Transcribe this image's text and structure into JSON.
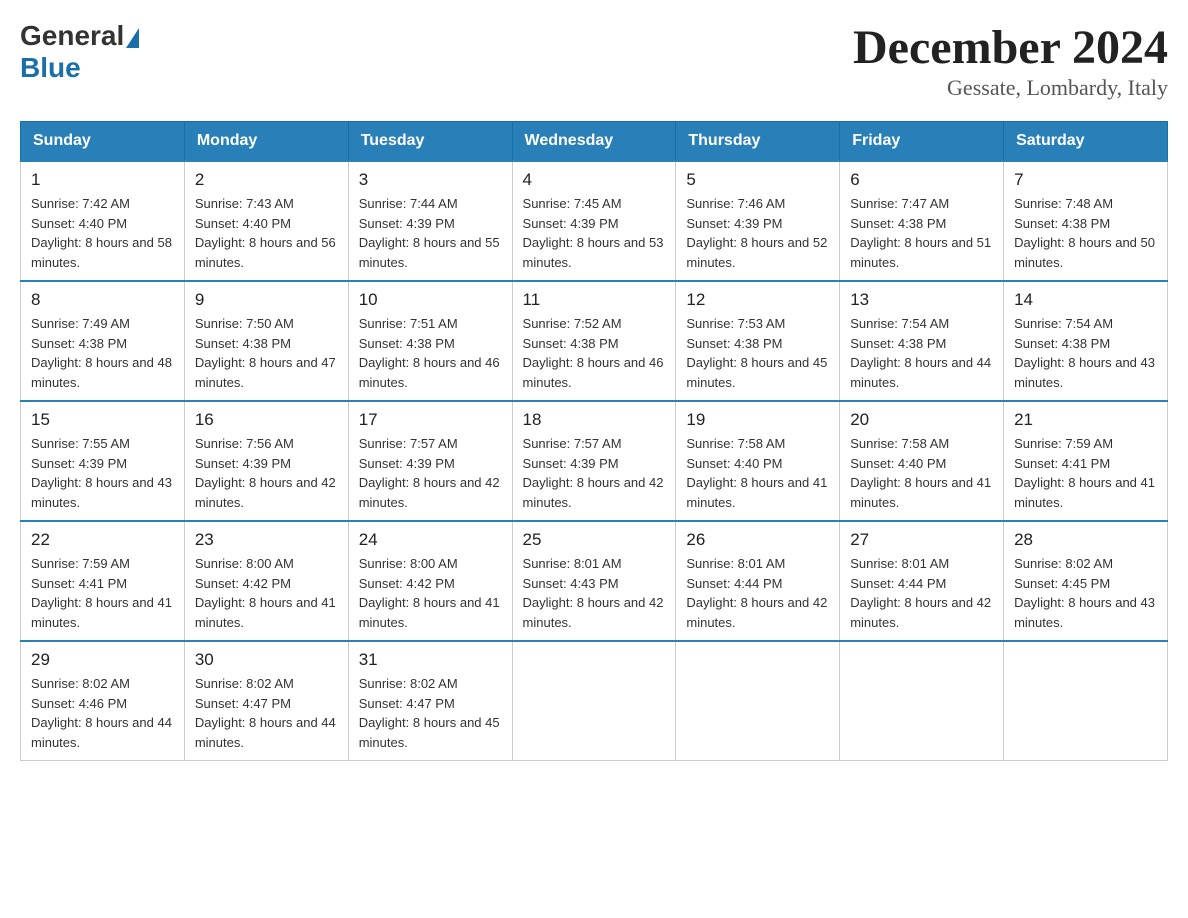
{
  "logo": {
    "general": "General",
    "blue": "Blue",
    "triangle": "▶"
  },
  "title": "December 2024",
  "location": "Gessate, Lombardy, Italy",
  "days_of_week": [
    "Sunday",
    "Monday",
    "Tuesday",
    "Wednesday",
    "Thursday",
    "Friday",
    "Saturday"
  ],
  "weeks": [
    [
      {
        "day": "1",
        "sunrise": "7:42 AM",
        "sunset": "4:40 PM",
        "daylight": "8 hours and 58 minutes."
      },
      {
        "day": "2",
        "sunrise": "7:43 AM",
        "sunset": "4:40 PM",
        "daylight": "8 hours and 56 minutes."
      },
      {
        "day": "3",
        "sunrise": "7:44 AM",
        "sunset": "4:39 PM",
        "daylight": "8 hours and 55 minutes."
      },
      {
        "day": "4",
        "sunrise": "7:45 AM",
        "sunset": "4:39 PM",
        "daylight": "8 hours and 53 minutes."
      },
      {
        "day": "5",
        "sunrise": "7:46 AM",
        "sunset": "4:39 PM",
        "daylight": "8 hours and 52 minutes."
      },
      {
        "day": "6",
        "sunrise": "7:47 AM",
        "sunset": "4:38 PM",
        "daylight": "8 hours and 51 minutes."
      },
      {
        "day": "7",
        "sunrise": "7:48 AM",
        "sunset": "4:38 PM",
        "daylight": "8 hours and 50 minutes."
      }
    ],
    [
      {
        "day": "8",
        "sunrise": "7:49 AM",
        "sunset": "4:38 PM",
        "daylight": "8 hours and 48 minutes."
      },
      {
        "day": "9",
        "sunrise": "7:50 AM",
        "sunset": "4:38 PM",
        "daylight": "8 hours and 47 minutes."
      },
      {
        "day": "10",
        "sunrise": "7:51 AM",
        "sunset": "4:38 PM",
        "daylight": "8 hours and 46 minutes."
      },
      {
        "day": "11",
        "sunrise": "7:52 AM",
        "sunset": "4:38 PM",
        "daylight": "8 hours and 46 minutes."
      },
      {
        "day": "12",
        "sunrise": "7:53 AM",
        "sunset": "4:38 PM",
        "daylight": "8 hours and 45 minutes."
      },
      {
        "day": "13",
        "sunrise": "7:54 AM",
        "sunset": "4:38 PM",
        "daylight": "8 hours and 44 minutes."
      },
      {
        "day": "14",
        "sunrise": "7:54 AM",
        "sunset": "4:38 PM",
        "daylight": "8 hours and 43 minutes."
      }
    ],
    [
      {
        "day": "15",
        "sunrise": "7:55 AM",
        "sunset": "4:39 PM",
        "daylight": "8 hours and 43 minutes."
      },
      {
        "day": "16",
        "sunrise": "7:56 AM",
        "sunset": "4:39 PM",
        "daylight": "8 hours and 42 minutes."
      },
      {
        "day": "17",
        "sunrise": "7:57 AM",
        "sunset": "4:39 PM",
        "daylight": "8 hours and 42 minutes."
      },
      {
        "day": "18",
        "sunrise": "7:57 AM",
        "sunset": "4:39 PM",
        "daylight": "8 hours and 42 minutes."
      },
      {
        "day": "19",
        "sunrise": "7:58 AM",
        "sunset": "4:40 PM",
        "daylight": "8 hours and 41 minutes."
      },
      {
        "day": "20",
        "sunrise": "7:58 AM",
        "sunset": "4:40 PM",
        "daylight": "8 hours and 41 minutes."
      },
      {
        "day": "21",
        "sunrise": "7:59 AM",
        "sunset": "4:41 PM",
        "daylight": "8 hours and 41 minutes."
      }
    ],
    [
      {
        "day": "22",
        "sunrise": "7:59 AM",
        "sunset": "4:41 PM",
        "daylight": "8 hours and 41 minutes."
      },
      {
        "day": "23",
        "sunrise": "8:00 AM",
        "sunset": "4:42 PM",
        "daylight": "8 hours and 41 minutes."
      },
      {
        "day": "24",
        "sunrise": "8:00 AM",
        "sunset": "4:42 PM",
        "daylight": "8 hours and 41 minutes."
      },
      {
        "day": "25",
        "sunrise": "8:01 AM",
        "sunset": "4:43 PM",
        "daylight": "8 hours and 42 minutes."
      },
      {
        "day": "26",
        "sunrise": "8:01 AM",
        "sunset": "4:44 PM",
        "daylight": "8 hours and 42 minutes."
      },
      {
        "day": "27",
        "sunrise": "8:01 AM",
        "sunset": "4:44 PM",
        "daylight": "8 hours and 42 minutes."
      },
      {
        "day": "28",
        "sunrise": "8:02 AM",
        "sunset": "4:45 PM",
        "daylight": "8 hours and 43 minutes."
      }
    ],
    [
      {
        "day": "29",
        "sunrise": "8:02 AM",
        "sunset": "4:46 PM",
        "daylight": "8 hours and 44 minutes."
      },
      {
        "day": "30",
        "sunrise": "8:02 AM",
        "sunset": "4:47 PM",
        "daylight": "8 hours and 44 minutes."
      },
      {
        "day": "31",
        "sunrise": "8:02 AM",
        "sunset": "4:47 PM",
        "daylight": "8 hours and 45 minutes."
      },
      null,
      null,
      null,
      null
    ]
  ]
}
